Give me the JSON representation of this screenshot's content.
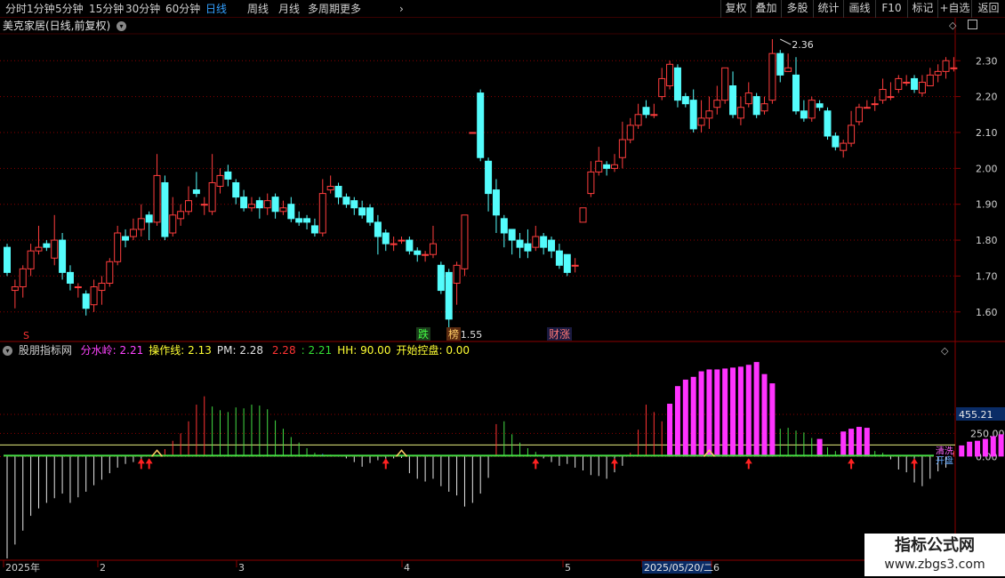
{
  "toolbar": {
    "periods": [
      "分时",
      "1分钟",
      "5分钟",
      "15分钟",
      "30分钟",
      "60分钟",
      "日线",
      "周线",
      "月线",
      "多周期",
      "更多"
    ],
    "active_period": "日线",
    "right_buttons": [
      "复权",
      "叠加",
      "多股",
      "统计",
      "画线",
      "F10",
      "标记",
      "+自选",
      "返回"
    ]
  },
  "main_header": {
    "title": "美克家居(日线,前复权)"
  },
  "indicator_header": {
    "name": "股朋指标网",
    "items": [
      {
        "label": "分水岭:",
        "value": "2.21",
        "color": "#ff44ff"
      },
      {
        "label": "操作线:",
        "value": "2.13",
        "color": "#ffff33"
      },
      {
        "label": "PM:",
        "value": "2.28",
        "color": "#e0e0e0"
      },
      {
        "label": "",
        "value": "2.28",
        "color": "#ff3333"
      },
      {
        "label": ":",
        "value": "2.21",
        "color": "#33dd33"
      },
      {
        "label": "HH:",
        "value": "90.00",
        "color": "#ffff33"
      },
      {
        "label": "开始控盘:",
        "value": "0.00",
        "color": "#ffff33"
      }
    ]
  },
  "colors": {
    "up": "#ff3d3d",
    "down": "#54fcfc",
    "grid": "#8b0000",
    "bg": "#000000"
  },
  "price_axis": {
    "labels": [
      "2.30",
      "2.20",
      "2.10",
      "2.00",
      "1.90",
      "1.80",
      "1.70",
      "1.60"
    ]
  },
  "indicator_axis": {
    "labels": [
      "455.21",
      "250.00",
      "0.00"
    ]
  },
  "date_axis": {
    "labels": [
      "2025年",
      "2",
      "3",
      "4",
      "5",
      "2025/05/20/二",
      "6"
    ]
  },
  "annotations": {
    "high_marker": "2.36",
    "low_marker": "1.55",
    "tags": [
      "跌",
      "榜",
      "财涨"
    ],
    "s_marker": "S",
    "side_tags": [
      "清洗",
      "开盘"
    ]
  },
  "chart_data": {
    "type": "candlestick",
    "y_range": [
      1.54,
      2.37
    ],
    "candles": [
      [
        1.78,
        1.71,
        1.79,
        1.7
      ],
      [
        1.66,
        1.67,
        1.69,
        1.61
      ],
      [
        1.67,
        1.72,
        1.73,
        1.64
      ],
      [
        1.72,
        1.77,
        1.79,
        1.7
      ],
      [
        1.77,
        1.78,
        1.84,
        1.76
      ],
      [
        1.79,
        1.78,
        1.8,
        1.77
      ],
      [
        1.75,
        1.8,
        1.87,
        1.73
      ],
      [
        1.8,
        1.71,
        1.82,
        1.69
      ],
      [
        1.71,
        1.68,
        1.73,
        1.66
      ],
      [
        1.67,
        1.67,
        1.68,
        1.64
      ],
      [
        1.65,
        1.61,
        1.66,
        1.59
      ],
      [
        1.62,
        1.67,
        1.69,
        1.6
      ],
      [
        1.66,
        1.68,
        1.7,
        1.62
      ],
      [
        1.68,
        1.74,
        1.75,
        1.67
      ],
      [
        1.74,
        1.82,
        1.84,
        1.73
      ],
      [
        1.81,
        1.8,
        1.83,
        1.78
      ],
      [
        1.81,
        1.83,
        1.86,
        1.8
      ],
      [
        1.83,
        1.86,
        1.9,
        1.81
      ],
      [
        1.87,
        1.85,
        1.88,
        1.8
      ],
      [
        1.85,
        1.98,
        2.04,
        1.84
      ],
      [
        1.96,
        1.81,
        1.98,
        1.8
      ],
      [
        1.82,
        1.87,
        1.92,
        1.81
      ],
      [
        1.86,
        1.88,
        1.9,
        1.84
      ],
      [
        1.88,
        1.91,
        1.95,
        1.87
      ],
      [
        1.94,
        1.93,
        1.99,
        1.92
      ],
      [
        1.9,
        1.9,
        1.92,
        1.87
      ],
      [
        1.88,
        1.96,
        2.04,
        1.87
      ],
      [
        1.95,
        1.98,
        2.0,
        1.93
      ],
      [
        1.99,
        1.97,
        2.01,
        1.95
      ],
      [
        1.96,
        1.92,
        1.97,
        1.9
      ],
      [
        1.92,
        1.89,
        1.94,
        1.88
      ],
      [
        1.89,
        1.9,
        1.92,
        1.88
      ],
      [
        1.91,
        1.89,
        1.92,
        1.86
      ],
      [
        1.89,
        1.91,
        1.93,
        1.87
      ],
      [
        1.92,
        1.88,
        1.93,
        1.86
      ],
      [
        1.88,
        1.89,
        1.91,
        1.87
      ],
      [
        1.9,
        1.86,
        1.92,
        1.85
      ],
      [
        1.86,
        1.85,
        1.88,
        1.84
      ],
      [
        1.86,
        1.85,
        1.87,
        1.83
      ],
      [
        1.84,
        1.82,
        1.86,
        1.81
      ],
      [
        1.82,
        1.93,
        1.97,
        1.81
      ],
      [
        1.94,
        1.95,
        1.98,
        1.93
      ],
      [
        1.95,
        1.92,
        1.96,
        1.9
      ],
      [
        1.92,
        1.9,
        1.93,
        1.89
      ],
      [
        1.91,
        1.89,
        1.92,
        1.87
      ],
      [
        1.89,
        1.87,
        1.91,
        1.86
      ],
      [
        1.89,
        1.85,
        1.9,
        1.84
      ],
      [
        1.85,
        1.81,
        1.87,
        1.76
      ],
      [
        1.82,
        1.79,
        1.83,
        1.77
      ],
      [
        1.79,
        1.79,
        1.81,
        1.77
      ],
      [
        1.8,
        1.8,
        1.81,
        1.79
      ],
      [
        1.8,
        1.77,
        1.81,
        1.76
      ],
      [
        1.77,
        1.76,
        1.78,
        1.74
      ],
      [
        1.76,
        1.76,
        1.77,
        1.74
      ],
      [
        1.76,
        1.79,
        1.84,
        1.75
      ],
      [
        1.73,
        1.66,
        1.74,
        1.65
      ],
      [
        1.71,
        1.58,
        1.72,
        1.55
      ],
      [
        1.68,
        1.73,
        1.74,
        1.62
      ],
      [
        1.72,
        1.87,
        1.87,
        1.7
      ],
      [
        2.1,
        2.1,
        2.1,
        2.1
      ],
      [
        2.21,
        2.03,
        2.22,
        2.02
      ],
      [
        2.02,
        1.93,
        2.03,
        1.88
      ],
      [
        1.94,
        1.87,
        1.97,
        1.82
      ],
      [
        1.86,
        1.82,
        1.87,
        1.78
      ],
      [
        1.83,
        1.8,
        1.82,
        1.76
      ],
      [
        1.8,
        1.78,
        1.82,
        1.75
      ],
      [
        1.79,
        1.77,
        1.83,
        1.75
      ],
      [
        1.78,
        1.81,
        1.84,
        1.77
      ],
      [
        1.81,
        1.78,
        1.82,
        1.76
      ],
      [
        1.8,
        1.77,
        1.81,
        1.75
      ],
      [
        1.77,
        1.73,
        1.79,
        1.72
      ],
      [
        1.76,
        1.71,
        1.76,
        1.7
      ],
      [
        1.73,
        1.73,
        1.75,
        1.71
      ],
      [
        1.85,
        1.89,
        1.89,
        1.85
      ],
      [
        1.93,
        1.99,
        2.02,
        1.92
      ],
      [
        1.99,
        2.02,
        2.06,
        1.98
      ],
      [
        2.01,
        2.0,
        2.02,
        1.98
      ],
      [
        2.0,
        2.01,
        2.04,
        1.99
      ],
      [
        2.03,
        2.08,
        2.13,
        2.0
      ],
      [
        2.08,
        2.12,
        2.14,
        2.07
      ],
      [
        2.12,
        2.15,
        2.18,
        2.11
      ],
      [
        2.17,
        2.15,
        2.19,
        2.14
      ],
      [
        2.15,
        2.15,
        2.18,
        2.14
      ],
      [
        2.2,
        2.25,
        2.28,
        2.19
      ],
      [
        2.23,
        2.29,
        2.3,
        2.22
      ],
      [
        2.28,
        2.19,
        2.29,
        2.17
      ],
      [
        2.2,
        2.18,
        2.21,
        2.17
      ],
      [
        2.19,
        2.11,
        2.22,
        2.1
      ],
      [
        2.12,
        2.14,
        2.19,
        2.1
      ],
      [
        2.14,
        2.16,
        2.2,
        2.11
      ],
      [
        2.17,
        2.19,
        2.23,
        2.15
      ],
      [
        2.19,
        2.28,
        2.28,
        2.18
      ],
      [
        2.23,
        2.15,
        2.27,
        2.14
      ],
      [
        2.14,
        2.17,
        2.2,
        2.12
      ],
      [
        2.18,
        2.21,
        2.24,
        2.17
      ],
      [
        2.2,
        2.15,
        2.21,
        2.14
      ],
      [
        2.16,
        2.18,
        2.2,
        2.15
      ],
      [
        2.19,
        2.32,
        2.36,
        2.18
      ],
      [
        2.32,
        2.26,
        2.33,
        2.24
      ],
      [
        2.27,
        2.28,
        2.32,
        2.27
      ],
      [
        2.26,
        2.16,
        2.31,
        2.15
      ],
      [
        2.16,
        2.14,
        2.19,
        2.13
      ],
      [
        2.14,
        2.19,
        2.2,
        2.13
      ],
      [
        2.18,
        2.17,
        2.19,
        2.16
      ],
      [
        2.16,
        2.09,
        2.17,
        2.08
      ],
      [
        2.09,
        2.06,
        2.1,
        2.05
      ],
      [
        2.05,
        2.07,
        2.08,
        2.03
      ],
      [
        2.07,
        2.12,
        2.16,
        2.06
      ],
      [
        2.13,
        2.17,
        2.18,
        2.12
      ],
      [
        2.17,
        2.17,
        2.19,
        2.17
      ],
      [
        2.18,
        2.18,
        2.2,
        2.16
      ],
      [
        2.19,
        2.22,
        2.25,
        2.18
      ],
      [
        2.2,
        2.2,
        2.24,
        2.19
      ],
      [
        2.22,
        2.25,
        2.26,
        2.21
      ],
      [
        2.24,
        2.24,
        2.26,
        2.23
      ],
      [
        2.25,
        2.22,
        2.26,
        2.21
      ],
      [
        2.21,
        2.24,
        2.26,
        2.2
      ],
      [
        2.23,
        2.26,
        2.28,
        2.23
      ],
      [
        2.26,
        2.27,
        2.29,
        2.24
      ],
      [
        2.27,
        2.3,
        2.31,
        2.25
      ],
      [
        2.28,
        2.28,
        2.31,
        2.27
      ]
    ],
    "indicator": {
      "type": "bar",
      "y_range": [
        -1100,
        1050
      ],
      "bars": [
        [
          -1100,
          "w"
        ],
        [
          -950,
          "w"
        ],
        [
          -800,
          "w"
        ],
        [
          -640,
          "w"
        ],
        [
          -560,
          "w"
        ],
        [
          -500,
          "w"
        ],
        [
          -450,
          "w"
        ],
        [
          -400,
          "w"
        ],
        [
          -500,
          "w"
        ],
        [
          -440,
          "w"
        ],
        [
          -380,
          "w"
        ],
        [
          -310,
          "w"
        ],
        [
          -250,
          "w"
        ],
        [
          -180,
          "w"
        ],
        [
          -120,
          "w"
        ],
        [
          -80,
          "w"
        ],
        [
          -60,
          "w"
        ],
        [
          -40,
          "w"
        ],
        [
          0,
          "r"
        ],
        [
          20,
          "r"
        ],
        [
          80,
          "r"
        ],
        [
          170,
          "r"
        ],
        [
          250,
          "r"
        ],
        [
          380,
          "r"
        ],
        [
          560,
          "r"
        ],
        [
          650,
          "r"
        ],
        [
          540,
          "g"
        ],
        [
          500,
          "g"
        ],
        [
          480,
          "g"
        ],
        [
          530,
          "g"
        ],
        [
          520,
          "g"
        ],
        [
          560,
          "g"
        ],
        [
          550,
          "g"
        ],
        [
          510,
          "g"
        ],
        [
          390,
          "g"
        ],
        [
          300,
          "g"
        ],
        [
          210,
          "g"
        ],
        [
          150,
          "g"
        ],
        [
          90,
          "g"
        ],
        [
          40,
          "g"
        ],
        [
          30,
          "b"
        ],
        [
          20,
          "g"
        ],
        [
          15,
          "b"
        ],
        [
          -20,
          "w"
        ],
        [
          -60,
          "w"
        ],
        [
          -110,
          "w"
        ],
        [
          -70,
          "w"
        ],
        [
          -40,
          "w"
        ],
        [
          -25,
          "w"
        ],
        [
          -20,
          "w"
        ],
        [
          -15,
          "w"
        ],
        [
          -180,
          "w"
        ],
        [
          -240,
          "w"
        ],
        [
          -270,
          "w"
        ],
        [
          -240,
          "w"
        ],
        [
          -320,
          "w"
        ],
        [
          -380,
          "w"
        ],
        [
          -420,
          "w"
        ],
        [
          -540,
          "w"
        ],
        [
          -500,
          "w"
        ],
        [
          -400,
          "w"
        ],
        [
          -230,
          "w"
        ],
        [
          350,
          "r"
        ],
        [
          380,
          "g"
        ],
        [
          240,
          "g"
        ],
        [
          150,
          "g"
        ],
        [
          90,
          "g"
        ],
        [
          50,
          "g"
        ],
        [
          -20,
          "w"
        ],
        [
          -60,
          "w"
        ],
        [
          -100,
          "w"
        ],
        [
          -80,
          "w"
        ],
        [
          -120,
          "w"
        ],
        [
          -150,
          "w"
        ],
        [
          -200,
          "w"
        ],
        [
          -210,
          "w"
        ],
        [
          -240,
          "w"
        ],
        [
          -170,
          "w"
        ],
        [
          -100,
          "w"
        ],
        [
          40,
          "r"
        ],
        [
          290,
          "r"
        ],
        [
          560,
          "r"
        ],
        [
          480,
          "r"
        ],
        [
          380,
          "r"
        ],
        [
          570,
          "m"
        ],
        [
          760,
          "m"
        ],
        [
          830,
          "m"
        ],
        [
          860,
          "m"
        ],
        [
          920,
          "m"
        ],
        [
          940,
          "m"
        ],
        [
          940,
          "m"
        ],
        [
          950,
          "m"
        ],
        [
          960,
          "m"
        ],
        [
          970,
          "m"
        ],
        [
          990,
          "m"
        ],
        [
          1020,
          "m"
        ],
        [
          890,
          "m"
        ],
        [
          790,
          "m"
        ],
        [
          300,
          "g"
        ],
        [
          310,
          "g"
        ],
        [
          280,
          "g"
        ],
        [
          260,
          "g"
        ],
        [
          200,
          "g"
        ],
        [
          190,
          "m"
        ],
        [
          100,
          "g"
        ],
        [
          60,
          "g"
        ],
        [
          270,
          "m"
        ],
        [
          300,
          "m"
        ],
        [
          320,
          "m"
        ],
        [
          310,
          "m"
        ],
        [
          60,
          "g"
        ],
        [
          40,
          "g"
        ],
        [
          -30,
          "w"
        ],
        [
          -140,
          "w"
        ],
        [
          -170,
          "w"
        ],
        [
          -280,
          "w"
        ],
        [
          -320,
          "w"
        ],
        [
          -240,
          "w"
        ],
        [
          -160,
          "w"
        ],
        [
          -120,
          "w"
        ],
        [
          60,
          "r"
        ],
        [
          120,
          "m"
        ],
        [
          160,
          "m"
        ],
        [
          170,
          "m"
        ],
        [
          190,
          "m"
        ],
        [
          220,
          "m"
        ],
        [
          240,
          "m"
        ],
        [
          250,
          "m"
        ],
        [
          260,
          "m"
        ],
        [
          270,
          "m"
        ],
        [
          250,
          "m"
        ]
      ]
    },
    "signal_arrows": [
      17,
      18,
      48,
      67,
      77,
      94,
      107,
      115,
      127,
      139,
      143,
      159,
      163
    ],
    "triangles": [
      19,
      50,
      89,
      131
    ]
  }
}
